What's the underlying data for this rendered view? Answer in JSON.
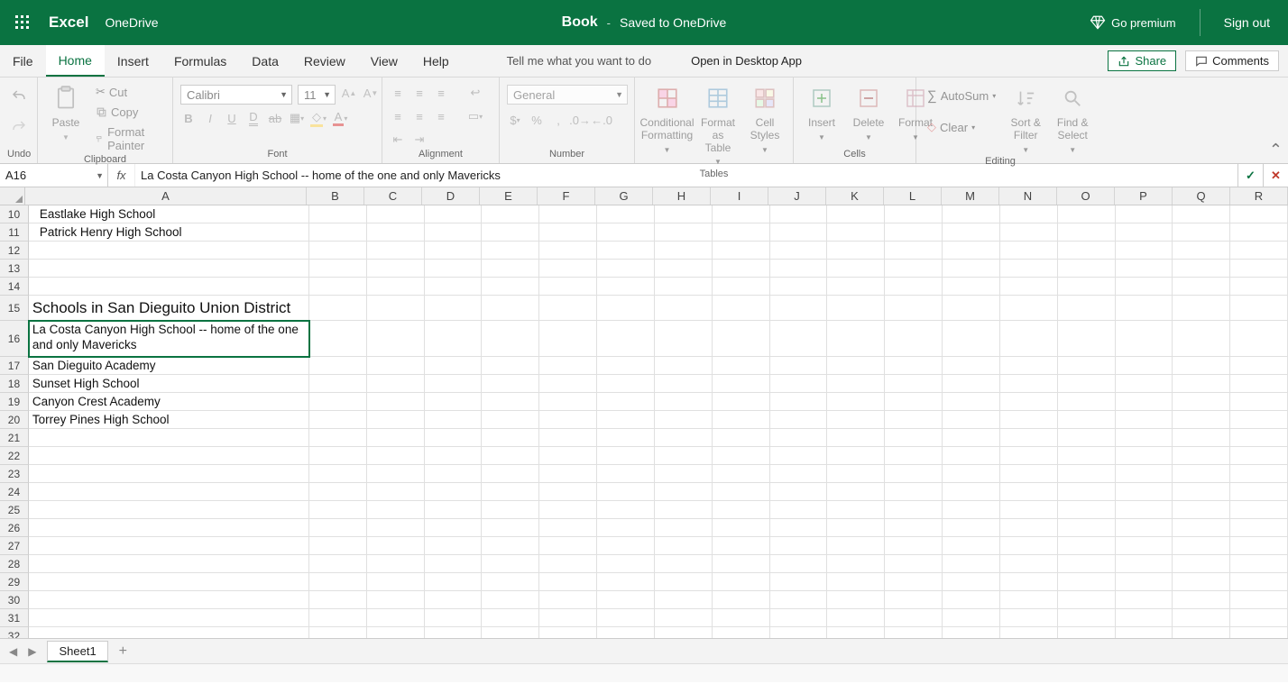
{
  "title": {
    "app": "Excel",
    "location": "OneDrive",
    "doc": "Book",
    "dash": "-",
    "saved": "Saved to OneDrive",
    "premium": "Go premium",
    "signout": "Sign out"
  },
  "tabs": {
    "file": "File",
    "home": "Home",
    "insert": "Insert",
    "formulas": "Formulas",
    "data": "Data",
    "review": "Review",
    "view": "View",
    "help": "Help",
    "tellme": "Tell me what you want to do",
    "desktop": "Open in Desktop App",
    "share": "Share",
    "comments": "Comments"
  },
  "ribbon": {
    "undo": "Undo",
    "paste": "Paste",
    "cut": "Cut",
    "copy": "Copy",
    "fmtpaint": "Format Painter",
    "clip": "Clipboard",
    "font_name": "Calibri",
    "font_size": "11",
    "font": "Font",
    "align": "Alignment",
    "numfmt": "General",
    "number": "Number",
    "cond": "Conditional Formatting",
    "astable": "Format as Table",
    "cellstyles": "Cell Styles",
    "tables": "Tables",
    "ins": "Insert",
    "del": "Delete",
    "fmt": "Format",
    "cells": "Cells",
    "autosum": "AutoSum",
    "clear": "Clear",
    "sort": "Sort & Filter",
    "find": "Find & Select",
    "editing": "Editing"
  },
  "formula": {
    "ref": "A16",
    "text": "La Costa Canyon High School -- home of the one and only Mavericks"
  },
  "columns": [
    "A",
    "B",
    "C",
    "D",
    "E",
    "F",
    "G",
    "H",
    "I",
    "J",
    "K",
    "L",
    "M",
    "N",
    "O",
    "P",
    "Q",
    "R"
  ],
  "rows": [
    {
      "n": "10",
      "a": "Eastlake High School",
      "indent": true
    },
    {
      "n": "11",
      "a": "Patrick Henry High School",
      "indent": true
    },
    {
      "n": "12",
      "a": ""
    },
    {
      "n": "13",
      "a": ""
    },
    {
      "n": "14",
      "a": ""
    },
    {
      "n": "15",
      "a": "Schools in San Dieguito Union District",
      "heading": true
    },
    {
      "n": "16",
      "a": "La Costa Canyon High School -- home of the one and only Mavericks",
      "sel": true,
      "tall": true
    },
    {
      "n": "17",
      "a": "San Dieguito Academy"
    },
    {
      "n": "18",
      "a": "Sunset High School"
    },
    {
      "n": "19",
      "a": "Canyon Crest Academy"
    },
    {
      "n": "20",
      "a": "Torrey Pines High School"
    },
    {
      "n": "21",
      "a": ""
    },
    {
      "n": "22",
      "a": ""
    },
    {
      "n": "23",
      "a": ""
    },
    {
      "n": "24",
      "a": ""
    },
    {
      "n": "25",
      "a": ""
    },
    {
      "n": "26",
      "a": ""
    },
    {
      "n": "27",
      "a": ""
    },
    {
      "n": "28",
      "a": ""
    },
    {
      "n": "29",
      "a": ""
    },
    {
      "n": "30",
      "a": ""
    },
    {
      "n": "31",
      "a": ""
    },
    {
      "n": "32",
      "a": ""
    }
  ],
  "sheet": {
    "name": "Sheet1"
  }
}
